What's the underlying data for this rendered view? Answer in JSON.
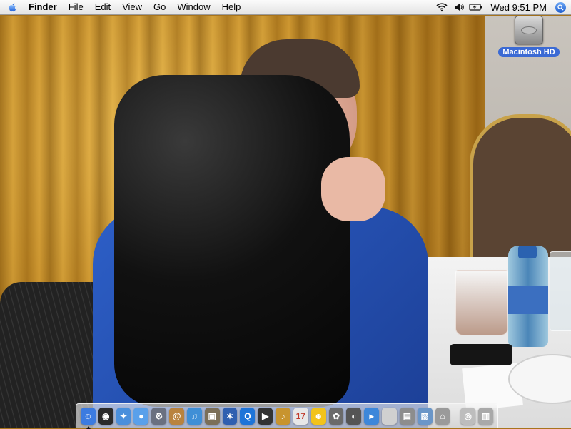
{
  "menubar": {
    "apple_icon": "apple-logo-icon",
    "app_name": "Finder",
    "menus": [
      "File",
      "Edit",
      "View",
      "Go",
      "Window",
      "Help"
    ],
    "status_icons": [
      "wifi-icon",
      "volume-icon",
      "battery-icon"
    ],
    "clock": "Wed 9:51 PM",
    "spotlight_icon": "spotlight-icon"
  },
  "desktop": {
    "icons": [
      {
        "label": "Macintosh HD",
        "icon": "hard-drive-icon"
      }
    ]
  },
  "dock": {
    "apps": [
      {
        "name": "finder-icon",
        "color": "#3c7be0",
        "glyph": "☺",
        "running": true
      },
      {
        "name": "dashboard-icon",
        "color": "#2a2a2a",
        "glyph": "◉",
        "running": false
      },
      {
        "name": "safari-icon",
        "color": "#4a8fdc",
        "glyph": "✦",
        "running": false
      },
      {
        "name": "ichat-icon",
        "color": "#5aa0ea",
        "glyph": "●",
        "running": false
      },
      {
        "name": "system-preferences-icon",
        "color": "#6a7080",
        "glyph": "⚙",
        "running": false
      },
      {
        "name": "address-book-icon",
        "color": "#b9833e",
        "glyph": "@",
        "running": false
      },
      {
        "name": "itunes-icon",
        "color": "#3f8fd6",
        "glyph": "♫",
        "running": false
      },
      {
        "name": "iphoto-icon",
        "color": "#7b6f58",
        "glyph": "▣",
        "running": false
      },
      {
        "name": "imovie-icon",
        "color": "#2f5fb0",
        "glyph": "✶",
        "running": false
      },
      {
        "name": "quicktime-icon",
        "color": "#1d74d8",
        "glyph": "Q",
        "running": false
      },
      {
        "name": "idvd-icon",
        "color": "#333333",
        "glyph": "▶",
        "running": false
      },
      {
        "name": "garageband-icon",
        "color": "#c8942e",
        "glyph": "♪",
        "running": false
      },
      {
        "name": "ical-icon",
        "color": "#e7e7e7",
        "glyph": "17",
        "running": false
      },
      {
        "name": "smile-icon",
        "color": "#f2c31a",
        "glyph": "☻",
        "running": false
      },
      {
        "name": "photo-booth-icon",
        "color": "#6a6a6a",
        "glyph": "✿",
        "running": false
      },
      {
        "name": "time-machine-icon",
        "color": "#555555",
        "glyph": "◐",
        "running": false
      },
      {
        "name": "front-row-icon",
        "color": "#3d87da",
        "glyph": "▸",
        "running": false
      },
      {
        "name": "apple-icon",
        "color": "#d0d0d0",
        "glyph": "",
        "running": false
      },
      {
        "name": "printer-icon",
        "color": "#8d8d8d",
        "glyph": "▤",
        "running": false
      },
      {
        "name": "preview-icon",
        "color": "#6a96c8",
        "glyph": "▧",
        "running": false
      },
      {
        "name": "utility-icon",
        "color": "#9a9a9a",
        "glyph": "⌂",
        "running": false
      }
    ],
    "trailing": [
      {
        "name": "downloads-stack-icon",
        "color": "#bdbdbd",
        "glyph": "◎"
      },
      {
        "name": "trash-icon",
        "color": "#a9a9a9",
        "glyph": "▥"
      }
    ]
  }
}
